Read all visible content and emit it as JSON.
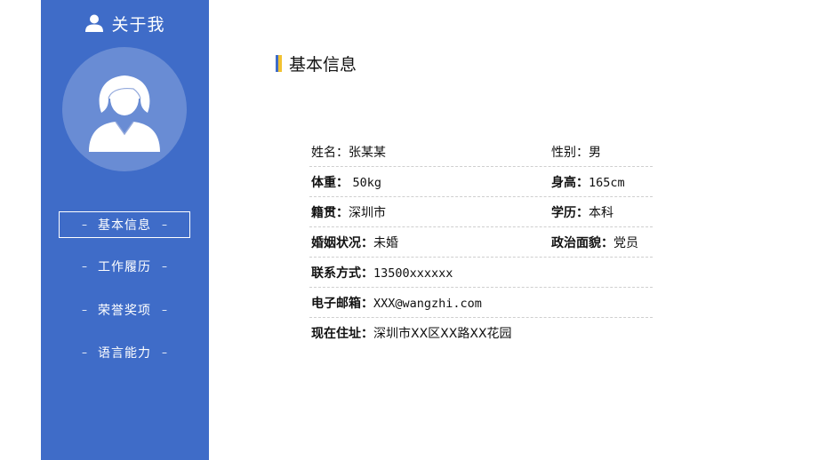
{
  "sidebar": {
    "title": "关于我",
    "nav": [
      {
        "label": "基本信息",
        "active": true
      },
      {
        "label": "工作履历",
        "active": false
      },
      {
        "label": "荣誉奖项",
        "active": false
      },
      {
        "label": "语言能力",
        "active": false
      }
    ],
    "dash": "–"
  },
  "section": {
    "title": "基本信息"
  },
  "info": {
    "name_label": "姓名：",
    "name_value": "张某某",
    "gender_label": "性别：",
    "gender_value": "男",
    "weight_label": "体重：",
    "weight_value": "50kg",
    "height_label": "身高：",
    "height_value": "165cm",
    "hometown_label": "籍贯：",
    "hometown_value": "深圳市",
    "education_label": "学历：",
    "education_value": "本科",
    "marital_label": "婚姻状况：",
    "marital_value": "未婚",
    "political_label": "政治面貌：",
    "political_value": "党员",
    "contact_label": "联系方式：",
    "contact_value": "13500xxxxxx",
    "email_label": "电子邮箱：",
    "email_value": "XXX@wangzhi.com",
    "address_label": "现在住址：",
    "address_value": "深圳市XX区XX路XX花园"
  },
  "colors": {
    "sidebar": "#3f6cc8",
    "accent_yellow": "#f2c230"
  },
  "icons": {
    "header": "user-icon",
    "avatar": "female-avatar-icon"
  }
}
